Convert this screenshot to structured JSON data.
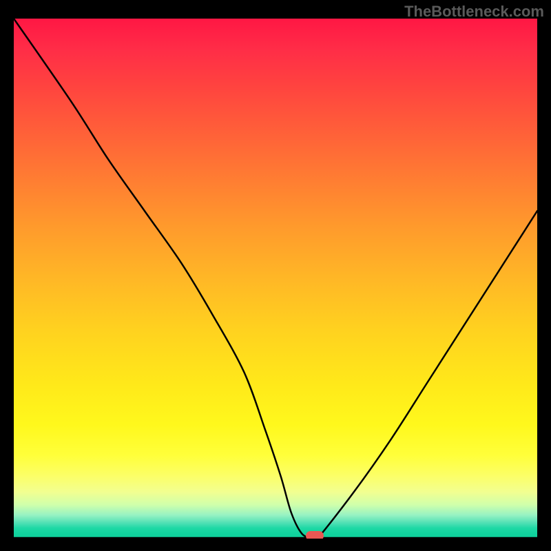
{
  "attribution": "TheBottleneck.com",
  "colors": {
    "page_bg": "#000000",
    "attribution_text": "#5a5a5a",
    "curve_stroke": "#000000",
    "marker_fill": "#ea5753"
  },
  "chart_data": {
    "type": "line",
    "title": "",
    "xlabel": "",
    "ylabel": "",
    "xlim": [
      0,
      100
    ],
    "ylim": [
      0,
      100
    ],
    "gradient_stops": [
      {
        "pos": 0,
        "color": "#ff1744"
      },
      {
        "pos": 50,
        "color": "#ffb726"
      },
      {
        "pos": 84,
        "color": "#ffff3a"
      },
      {
        "pos": 100,
        "color": "#0fd19c"
      }
    ],
    "series": [
      {
        "name": "bottleneck-curve",
        "x": [
          0,
          11,
          18,
          25,
          32,
          38,
          44,
          48,
          51,
          53,
          55,
          57,
          58,
          65,
          72,
          79,
          86,
          93,
          100
        ],
        "values": [
          100,
          84,
          73,
          63,
          53,
          43,
          32,
          21,
          12,
          5,
          1,
          0,
          0,
          9,
          19,
          30,
          41,
          52,
          63
        ]
      }
    ],
    "marker": {
      "x": 57.5,
      "y": 0
    }
  }
}
